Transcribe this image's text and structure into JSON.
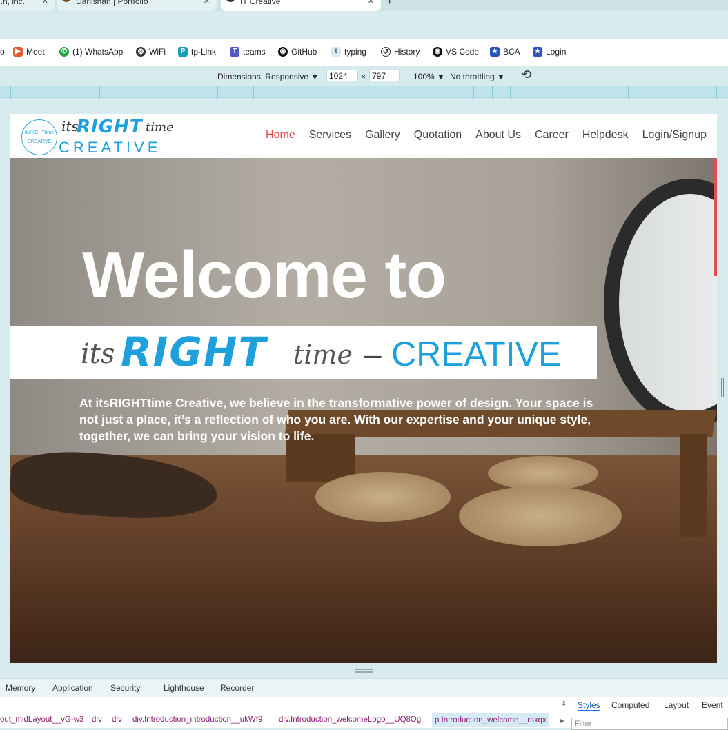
{
  "browser": {
    "tabs": [
      {
        "label": "...n, inc."
      },
      {
        "label": "Danishan | Portfolio"
      },
      {
        "label": "IT Creative"
      }
    ],
    "bookmarks": [
      "Meet",
      "(1) WhatsApp",
      "WiFi",
      "tp-Link",
      "teams",
      "GitHub",
      "typing",
      "History",
      "VS Code",
      "BCA",
      "Login"
    ]
  },
  "devtools_toolbar": {
    "dimensions_label": "Dimensions: Responsive ▼",
    "width": "1024",
    "times": "×",
    "height": "797",
    "zoom": "100% ▼",
    "throttling": "No throttling ▼"
  },
  "site": {
    "logo": {
      "its": "its",
      "right": "RIGHT",
      "time": "time",
      "creative": "CREATIVE",
      "seal_text": "itsRIGHTtime CREATIVE"
    },
    "nav": [
      "Home",
      "Services",
      "Gallery",
      "Quotation",
      "About Us",
      "Career",
      "Helpdesk",
      "Login/Signup"
    ],
    "hero_title": "Welcome to",
    "brand": {
      "its": "its",
      "right": "RIGHT",
      "time": "time",
      "dash": "–",
      "creative": "CREATIVE"
    },
    "intro_text": "At itsRIGHTtime Creative, we believe in the transformative power of design. Your space is not just a place, it’s a reflection of who you are. With our expertise and your unique style, together, we can bring your vision to life."
  },
  "devtools": {
    "panel_tabs": [
      "Memory",
      "Application",
      "Security",
      "Lighthouse",
      "Recorder"
    ],
    "breadcrumbs": [
      "out_midLayout__vG-w3",
      "div",
      "div",
      "div.Introduction_introduction__ukWf9",
      "div.Introduction_welcomeLogo__UQ8Og",
      "p.Introduction_welcome__rsxqx"
    ],
    "styles_tabs": [
      "Styles",
      "Computed",
      "Layout",
      "Event L"
    ],
    "filter_placeholder": "Filter"
  },
  "colors": {
    "accent": "#1ea0dd",
    "nav_active": "#e8474d"
  }
}
